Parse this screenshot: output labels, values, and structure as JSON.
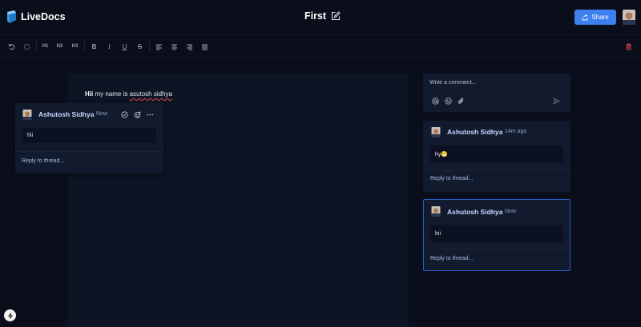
{
  "app": {
    "name": "LiveDocs"
  },
  "document": {
    "title": "First",
    "content_bold": "Hii",
    "content_rest": " my name is ",
    "content_misspelled": "asutosh sidhya"
  },
  "header": {
    "share_label": "Share"
  },
  "toolbar": {
    "h1": "H1",
    "h2": "H2",
    "h3": "H3",
    "bold": "B",
    "italic": "I",
    "underline": "U",
    "strike": "S"
  },
  "composer": {
    "placeholder": "Write a comment..."
  },
  "floating_thread": {
    "author": "Ashutosh Sidhya",
    "time": "Now",
    "body": "hii",
    "reply": "Reply to thread..."
  },
  "threads": [
    {
      "author": "Ashutosh Sidhya",
      "time": "14m ago",
      "body": "hy😁",
      "reply": "Reply to thread..."
    },
    {
      "author": "Ashutosh Sidhya",
      "time": "Now",
      "body": "hii",
      "reply": "Reply to thread..."
    }
  ],
  "colors": {
    "background": "#090e1a",
    "panel": "#121b2e",
    "accent": "#3f80f0",
    "delete": "#e5484d"
  }
}
